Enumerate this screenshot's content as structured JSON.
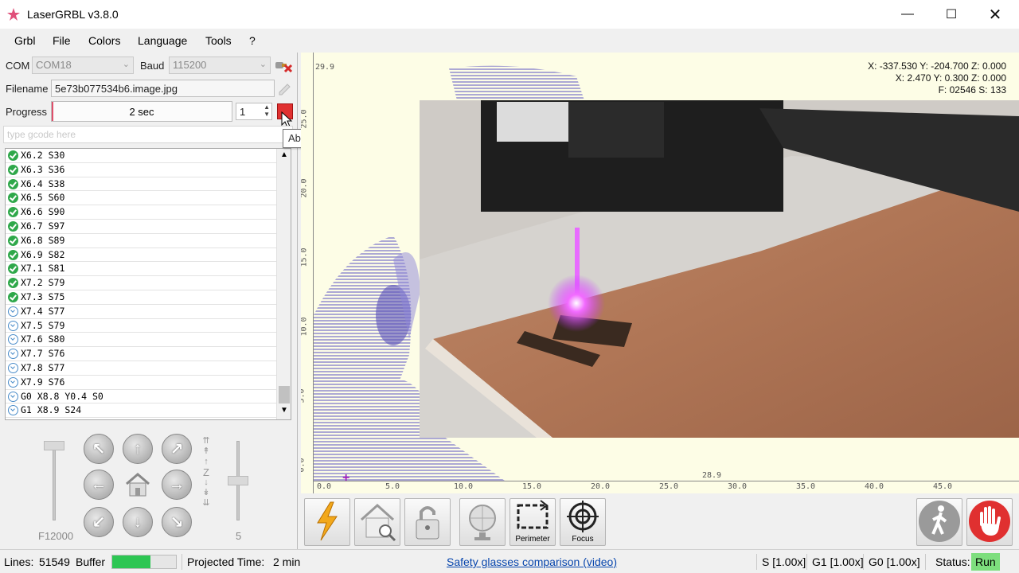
{
  "window": {
    "title": "LaserGRBL v3.8.0"
  },
  "menu": [
    "Grbl",
    "File",
    "Colors",
    "Language",
    "Tools",
    "?"
  ],
  "connection": {
    "com_label": "COM",
    "com_value": "COM18",
    "baud_label": "Baud",
    "baud_value": "115200"
  },
  "file": {
    "filename_label": "Filename",
    "filename_value": "5e73b077534b6.image.jpg"
  },
  "progress": {
    "label": "Progress",
    "text": "2 sec",
    "fraction": 0.01,
    "passes": "1"
  },
  "gcode_input": {
    "placeholder": "type gcode here"
  },
  "tooltip": "Abort Program",
  "gcode_lines": [
    {
      "text": "X6.2 S30",
      "status": "ok"
    },
    {
      "text": "X6.3 S36",
      "status": "ok"
    },
    {
      "text": "X6.4 S38",
      "status": "ok"
    },
    {
      "text": "X6.5 S60",
      "status": "ok"
    },
    {
      "text": "X6.6 S90",
      "status": "ok"
    },
    {
      "text": "X6.7 S97",
      "status": "ok"
    },
    {
      "text": "X6.8 S89",
      "status": "ok"
    },
    {
      "text": "X6.9 S82",
      "status": "ok"
    },
    {
      "text": "X7.1 S81",
      "status": "ok"
    },
    {
      "text": "X7.2 S79",
      "status": "ok"
    },
    {
      "text": "X7.3 S75",
      "status": "ok"
    },
    {
      "text": "X7.4 S77",
      "status": "wait"
    },
    {
      "text": "X7.5 S79",
      "status": "wait"
    },
    {
      "text": "X7.6 S80",
      "status": "wait"
    },
    {
      "text": "X7.7 S76",
      "status": "wait"
    },
    {
      "text": "X7.8 S77",
      "status": "wait"
    },
    {
      "text": "X7.9 S76",
      "status": "wait"
    },
    {
      "text": "G0 X8.8 Y0.4 S0",
      "status": "wait"
    },
    {
      "text": "G1 X8.9 S24",
      "status": "wait"
    }
  ],
  "jog": {
    "feed_label": "F12000",
    "step_label": "5"
  },
  "canvas": {
    "coords": [
      "X: -337.530 Y: -204.700 Z: 0.000",
      "X: 2.470 Y: 0.300 Z: 0.000",
      "F: 02546 S: 133"
    ],
    "top_left_label": "29.9",
    "bottom_label": "28.9",
    "x_ticks": [
      "0.0",
      "5.0",
      "10.0",
      "15.0",
      "20.0",
      "25.0",
      "30.0",
      "35.0",
      "40.0",
      "45.0"
    ],
    "y_ticks": [
      "25.0",
      "20.0",
      "15.0",
      "10.0",
      "5.0",
      "0.0"
    ]
  },
  "toolbar": {
    "perimeter": "Perimeter",
    "focus": "Focus"
  },
  "status": {
    "lines_label": "Lines:",
    "lines_value": "51549",
    "buffer_label": "Buffer",
    "buffer_fraction": 0.6,
    "projected_label": "Projected Time:",
    "projected_value": "2 min",
    "link": "Safety glasses comparison (video)",
    "s_override": "S [1.00x]",
    "g1_override": "G1 [1.00x]",
    "g0_override": "G0 [1.00x]",
    "status_label": "Status:",
    "status_value": "Run"
  },
  "colors": {
    "ok": "#2fa84a",
    "run": "#7dde7d",
    "abort": "#e03030",
    "link": "#0645ad"
  }
}
